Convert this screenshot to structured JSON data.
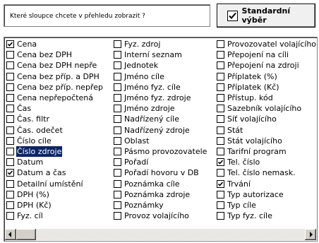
{
  "header": {
    "question": "Které sloupce chcete v přehledu zobrazit ?",
    "standard_button_label": "Standardní výběr",
    "standard_button_checked": true
  },
  "columns": [
    [
      {
        "label": "Cena",
        "checked": true
      },
      {
        "label": "Cena bez DPH",
        "checked": false
      },
      {
        "label": "Cena bez DPH nepře",
        "checked": false
      },
      {
        "label": "Cena bez příp. a DPH",
        "checked": false
      },
      {
        "label": "Cena bez příp. nepřep",
        "checked": false
      },
      {
        "label": "Cena nepřepočtená",
        "checked": false
      },
      {
        "label": "Čas",
        "checked": false
      },
      {
        "label": "Čas. filtr",
        "checked": false
      },
      {
        "label": "Čas. odečet",
        "checked": false
      },
      {
        "label": "Číslo cíle",
        "checked": false
      },
      {
        "label": "Číslo zdroje",
        "checked": false,
        "selected": true
      },
      {
        "label": "Datum",
        "checked": false
      },
      {
        "label": "Datum a čas",
        "checked": true
      },
      {
        "label": "Detailní umístění",
        "checked": false
      },
      {
        "label": "DPH (%)",
        "checked": false
      },
      {
        "label": "DPH (Kč)",
        "checked": false
      },
      {
        "label": "Fyz. cíl",
        "checked": false
      }
    ],
    [
      {
        "label": "Fyz. zdroj",
        "checked": false
      },
      {
        "label": "Interní seznam",
        "checked": false
      },
      {
        "label": "Jednotek",
        "checked": false
      },
      {
        "label": "Jméno cíle",
        "checked": false
      },
      {
        "label": "Jméno fyz. cíle",
        "checked": false
      },
      {
        "label": "Jméno fyz. zdroje",
        "checked": false
      },
      {
        "label": "Jméno zdroje",
        "checked": false
      },
      {
        "label": "Nadřízený cíle",
        "checked": false
      },
      {
        "label": "Nadřízený zdroje",
        "checked": false
      },
      {
        "label": "Oblast",
        "checked": false
      },
      {
        "label": "Pásmo provozovatele",
        "checked": false
      },
      {
        "label": "Pořadí",
        "checked": false
      },
      {
        "label": "Pořadí hovoru v DB",
        "checked": false
      },
      {
        "label": "Poznámka cíle",
        "checked": false
      },
      {
        "label": "Poznámka zdroje",
        "checked": false
      },
      {
        "label": "Poznámky",
        "checked": false
      },
      {
        "label": "Provoz volajícího",
        "checked": false
      }
    ],
    [
      {
        "label": "Provozovatel volajícího",
        "checked": false
      },
      {
        "label": "Přepojení na cíli",
        "checked": false
      },
      {
        "label": "Přepojení na zdroji",
        "checked": false
      },
      {
        "label": "Příplatek (%)",
        "checked": false
      },
      {
        "label": "Příplatek (Kč)",
        "checked": false
      },
      {
        "label": "Přístup. kód",
        "checked": false
      },
      {
        "label": "Sazebník volajícího",
        "checked": false
      },
      {
        "label": "Síť volajícího",
        "checked": false
      },
      {
        "label": "Stát",
        "checked": false
      },
      {
        "label": "Stát volajícího",
        "checked": false
      },
      {
        "label": "Tarifní program",
        "checked": false
      },
      {
        "label": "Tel. číslo",
        "checked": true
      },
      {
        "label": "Tel. číslo nemask.",
        "checked": false
      },
      {
        "label": "Trvání",
        "checked": true
      },
      {
        "label": "Typ autorizace",
        "checked": false
      },
      {
        "label": "Typ cíle",
        "checked": false
      },
      {
        "label": "Typ fyz. cíle",
        "checked": false
      }
    ]
  ],
  "icons": {
    "check": "checkmark-icon",
    "scroll_left": "arrow-left-icon",
    "scroll_right": "arrow-right-icon"
  },
  "colors": {
    "selection_bg": "#0a246a",
    "selection_fg": "#ffffff",
    "scrollbar_face": "#d4d0c8"
  }
}
